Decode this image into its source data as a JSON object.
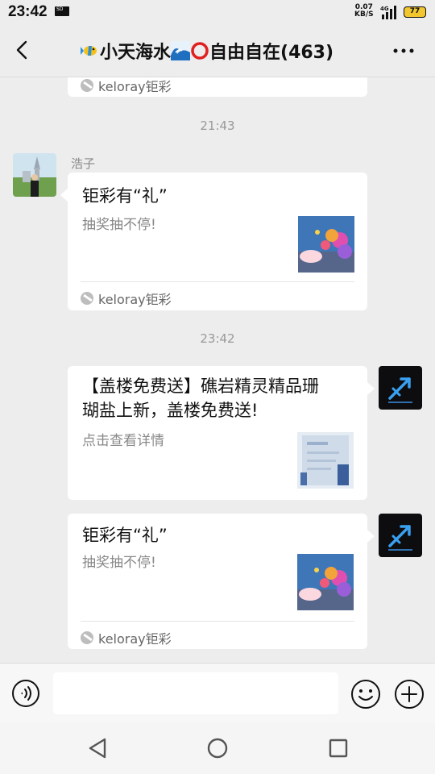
{
  "status_bar": {
    "time": "23:42",
    "sd_label": "SD",
    "net_speed_value": "0.07",
    "net_speed_unit": "KB/S",
    "network_type": "4G",
    "battery": "77"
  },
  "header": {
    "title": "小天海水",
    "title_suffix": "自由自在(463)",
    "back_icon": "chevron-left-icon",
    "more_icon": "more-dots-icon"
  },
  "messages": [
    {
      "type": "card-partial",
      "side": "left",
      "source": "keloray钜彩"
    },
    {
      "type": "timestamp",
      "text": "21:43"
    },
    {
      "type": "card",
      "side": "left",
      "sender": "浩子",
      "title": "钜彩有“礼”",
      "desc": "抽奖抽不停!",
      "source": "keloray钜彩"
    },
    {
      "type": "timestamp",
      "text": "23:42"
    },
    {
      "type": "card",
      "side": "right",
      "title": "【盖楼免费送】礁岩精灵精品珊瑚盐上新，盖楼免费送!",
      "title_line1": "【盖楼免费送】礁岩精灵精品珊",
      "title_line2": "瑚盐上新，盖楼免费送!",
      "desc": "点击查看详情"
    },
    {
      "type": "card",
      "side": "right",
      "title": "钜彩有“礼”",
      "desc": "抽奖抽不停!",
      "source": "keloray钜彩"
    }
  ],
  "input_bar": {
    "voice_icon": "voice-icon",
    "emoji_icon": "emoji-icon",
    "plus_icon": "plus-icon",
    "placeholder": ""
  },
  "system_nav": {
    "back_icon": "triangle-back-icon",
    "home_icon": "circle-home-icon",
    "recent_icon": "square-recent-icon"
  }
}
